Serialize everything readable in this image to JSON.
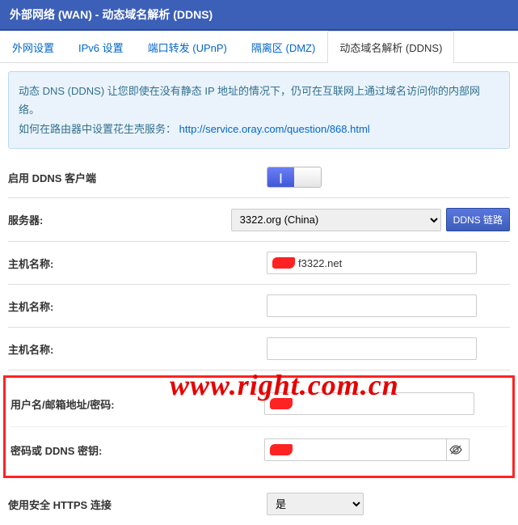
{
  "header": "外部网络 (WAN) - 动态域名解析 (DDNS)",
  "tabs": [
    "外网设置",
    "IPv6 设置",
    "端口转发 (UPnP)",
    "隔离区 (DMZ)",
    "动态域名解析 (DDNS)"
  ],
  "info": {
    "line1": "动态 DNS (DDNS) 让您即使在没有静态 IP 地址的情况下，仍可在互联网上通过域名访问你的内部网络。",
    "line2_pre": "如何在路由器中设置花生壳服务：",
    "link": "http://service.oray.com/question/868.html"
  },
  "rows": {
    "enable": "启用 DDNS 客户端",
    "server": "服务器:",
    "server_val": "3322.org (China)",
    "ddns_link": "DDNS 链路",
    "host1": "主机名称:",
    "host1_val": "f3322.net",
    "host2": "主机名称:",
    "host2_val": "",
    "host3": "主机名称:",
    "host3_val": "",
    "user": "用户名/邮箱地址/密码:",
    "user_val": "",
    "pass": "密码或 DDNS 密钥:",
    "pass_val": "",
    "https": "使用安全 HTTPS 连接",
    "https_val": "是"
  },
  "watermark": "www.right.com.cn"
}
